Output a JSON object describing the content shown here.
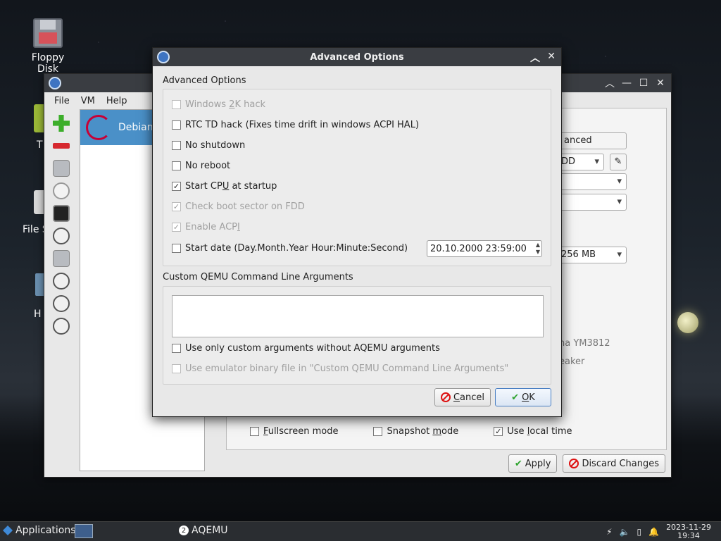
{
  "desktop": {
    "icons": [
      {
        "label": "Floppy Disk"
      },
      {
        "label": "T"
      },
      {
        "label": "File S"
      },
      {
        "label": "H"
      }
    ]
  },
  "main_window": {
    "menu": [
      "File",
      "VM",
      "Help"
    ],
    "vm_list": [
      {
        "name": "Debian"
      }
    ],
    "fragments": {
      "advanced_btn": "anced",
      "boot_combo": "DD",
      "memory_combo": "256 MB",
      "sound_card1": "na YM3812",
      "sound_card2": "eaker"
    },
    "bottom_checks": [
      {
        "label": "Fullscreen mode",
        "accel": "F",
        "rest": "ullscreen mode",
        "checked": false
      },
      {
        "label": "Snapshot mode",
        "pre": "Snapshot ",
        "accel": "m",
        "rest": "ode",
        "checked": false
      },
      {
        "label": "Use local time",
        "pre": "Use ",
        "accel": "l",
        "rest": "ocal time",
        "checked": true
      }
    ],
    "apply_label": "Apply",
    "discard_label": "Discard Changes"
  },
  "dialog": {
    "title": "Advanced Options",
    "group1_label": "Advanced Options",
    "options": [
      {
        "pre": "Windows ",
        "accel": "2",
        "rest": "K hack",
        "checked": false,
        "enabled": false
      },
      {
        "pre": "RTC TD hack (Fixes time drift in windows ACPI HAL)",
        "accel": "",
        "rest": "",
        "checked": false,
        "enabled": true
      },
      {
        "pre": "No shutdown",
        "accel": "",
        "rest": "",
        "checked": false,
        "enabled": true
      },
      {
        "pre": "No reboot",
        "accel": "",
        "rest": "",
        "checked": false,
        "enabled": true
      },
      {
        "pre": "Start CP",
        "accel": "U",
        "rest": " at startup",
        "checked": true,
        "enabled": true
      },
      {
        "pre": "Check boot sector on FDD",
        "accel": "",
        "rest": "",
        "checked": true,
        "enabled": false
      },
      {
        "pre": "Enable ACP",
        "accel": "I",
        "rest": "",
        "checked": true,
        "enabled": false
      },
      {
        "pre": "Start date (Day.Month.Year Hour:Minute:Second)",
        "accel": "",
        "rest": "",
        "checked": false,
        "enabled": true
      }
    ],
    "start_date_value": "20.10.2000 23:59:00",
    "group2_label": "Custom QEMU Command Line Arguments",
    "custom_args_value": "",
    "custom_opts": [
      {
        "label": "Use only custom arguments without AQEMU arguments",
        "checked": false,
        "enabled": true
      },
      {
        "label": "Use emulator binary file in \"Custom QEMU Command Line Arguments\"",
        "checked": false,
        "enabled": false
      }
    ],
    "cancel_label": "Cancel",
    "cancel_accel": "C",
    "cancel_rest": "ancel",
    "ok_label": "OK",
    "ok_accel": "O",
    "ok_rest": "K"
  },
  "taskbar": {
    "applications_label": "Applications",
    "task_label": "AQEMU",
    "task_badge": "2",
    "date": "2023-11-29",
    "time": "19:34"
  }
}
